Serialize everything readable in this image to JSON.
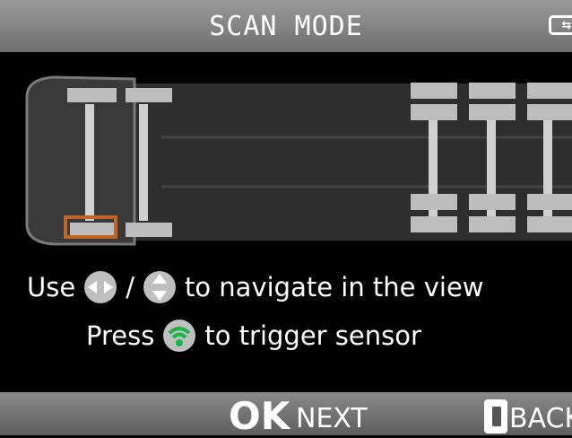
{
  "header": {
    "title": "SCAN MODE"
  },
  "instructions": {
    "line1_use": "Use",
    "line1_slash": "/",
    "line1_rest": "to navigate in the view",
    "line2_press": "Press",
    "line2_rest": "to trigger sensor"
  },
  "footer": {
    "ok_label": "OK",
    "next_label": "NEXT",
    "back_label": "BACK"
  },
  "colors": {
    "selection": "#c0652a",
    "header_bg": "#8a8a8a",
    "trigger_icon": "#1fb24a"
  },
  "icons": [
    "battery-icon",
    "left-right-arrows-icon",
    "up-down-arrows-icon",
    "wifi-trigger-icon",
    "c-button-icon"
  ]
}
